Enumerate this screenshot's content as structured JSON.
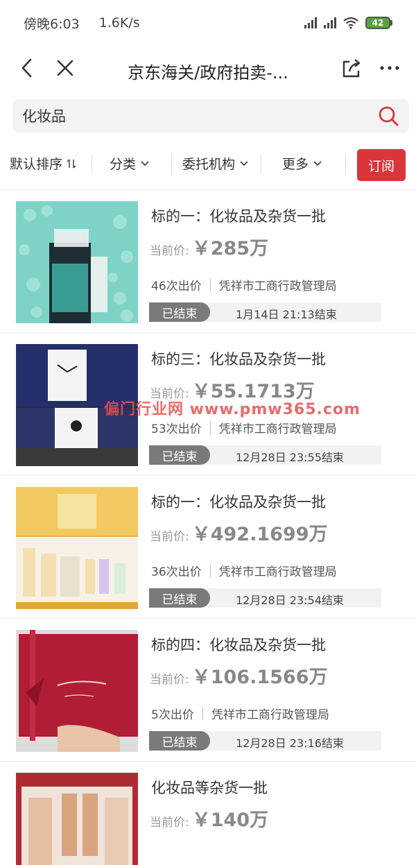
{
  "status_bar": {
    "time": "傍晚6:03",
    "speed": "1.6K/s",
    "battery": "42"
  },
  "nav": {
    "title": "京东海关/政府拍卖-...",
    "back_icon": "chevron-left-icon",
    "close_icon": "close-icon",
    "share_icon": "share-icon",
    "more_icon": "more-icon"
  },
  "search": {
    "value": "化妆品",
    "icon": "search-icon"
  },
  "filters": {
    "sort": "默认排序",
    "category": "分类",
    "agency": "委托机构",
    "more": "更多",
    "subscribe": "订阅"
  },
  "items": [
    {
      "title": "标的一：化妆品及杂货一批",
      "price_label": "当前价:",
      "price": "￥285万",
      "bids": "46次出价",
      "agency": "凭祥市工商行政管理局",
      "status": "已结束",
      "end_time": "1月14日 21:13结束"
    },
    {
      "title": "标的三：化妆品及杂货一批",
      "price_label": "当前价:",
      "price": "￥55.1713万",
      "bids": "53次出价",
      "agency": "凭祥市工商行政管理局",
      "status": "已结束",
      "end_time": "12月28日 23:55结束"
    },
    {
      "title": "标的一：化妆品及杂货一批",
      "price_label": "当前价:",
      "price": "￥492.1699万",
      "bids": "36次出价",
      "agency": "凭祥市工商行政管理局",
      "status": "已结束",
      "end_time": "12月28日 23:54结束"
    },
    {
      "title": "标的四：化妆品及杂货一批",
      "price_label": "当前价:",
      "price": "￥106.1566万",
      "bids": "5次出价",
      "agency": "凭祥市工商行政管理局",
      "status": "已结束",
      "end_time": "12月28日 23:16结束"
    },
    {
      "title": "化妆品等杂货一批",
      "price_label": "当前价:",
      "price": "￥140万"
    }
  ],
  "watermark": "偏门行业网 www.pmw365.com",
  "colors": {
    "accent": "#d9353a",
    "search_icon": "#d9353a",
    "status_badge": "#7a7a7a"
  }
}
